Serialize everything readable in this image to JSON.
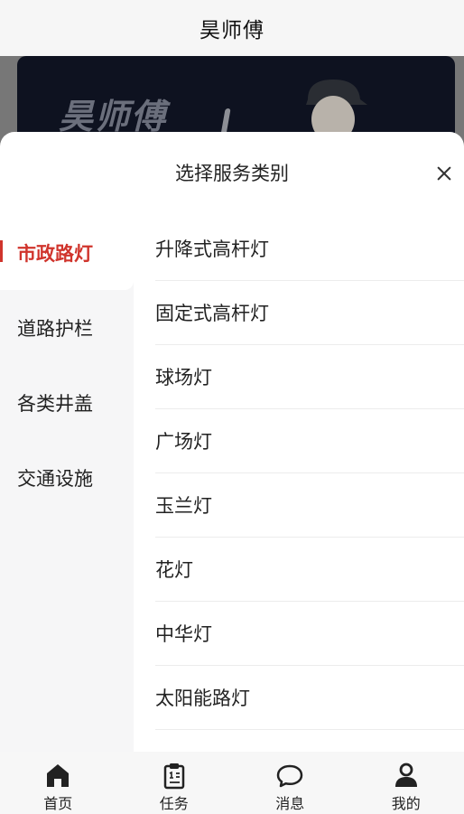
{
  "header": {
    "title": "昊师傅"
  },
  "banner": {
    "text": "昊师傅"
  },
  "sheet": {
    "title": "选择服务类别",
    "categories": [
      {
        "label": "市政路灯",
        "active": true
      },
      {
        "label": "道路护栏",
        "active": false
      },
      {
        "label": "各类井盖",
        "active": false
      },
      {
        "label": "交通设施",
        "active": false
      }
    ],
    "subitems": [
      "升降式高杆灯",
      "固定式高杆灯",
      "球场灯",
      "广场灯",
      "玉兰灯",
      "花灯",
      "中华灯",
      "太阳能路灯"
    ]
  },
  "tabbar": {
    "items": [
      {
        "label": "首页",
        "icon": "home-icon"
      },
      {
        "label": "任务",
        "icon": "clipboard-icon"
      },
      {
        "label": "消息",
        "icon": "chat-bubble-icon"
      },
      {
        "label": "我的",
        "icon": "user-icon"
      }
    ]
  },
  "colors": {
    "accent": "#d0342c",
    "sidebar_bg": "#f6f6f7",
    "tabbar_bg": "#f7f7f7"
  }
}
